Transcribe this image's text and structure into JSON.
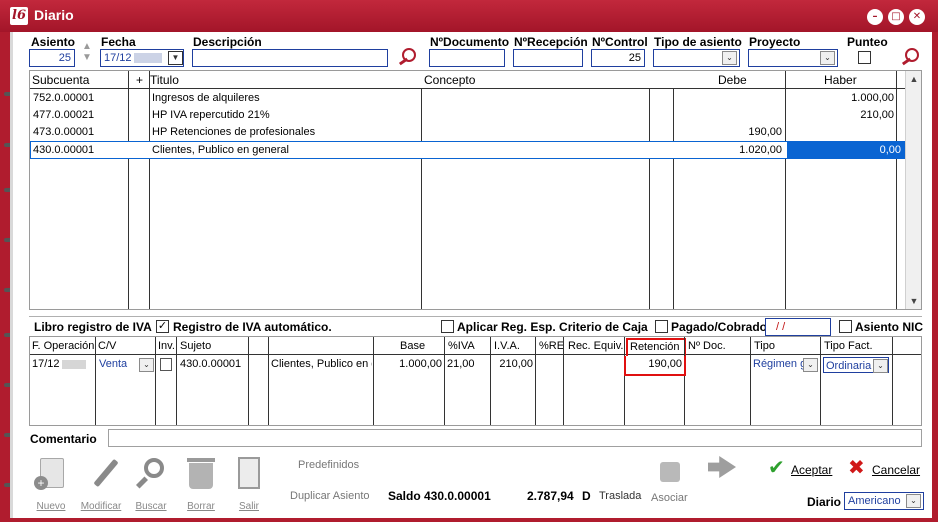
{
  "window": {
    "title": "Diario",
    "logo": "l6"
  },
  "header": {
    "asiento_label": "Asiento",
    "asiento_value": "25",
    "fecha_label": "Fecha",
    "fecha_value": "17/12",
    "descripcion_label": "Descripción",
    "descripcion_value": "",
    "ndocumento_label": "NºDocumento",
    "nrecepcion_label": "NºRecepción",
    "ncontrol_label": "NºControl",
    "ncontrol_value": "25",
    "tipo_asiento_label": "Tipo de asiento",
    "proyecto_label": "Proyecto",
    "punteo_label": "Punteo"
  },
  "grid": {
    "columns": {
      "subcuenta": "Subcuenta",
      "plus": "+",
      "titulo": "Titulo",
      "concepto": "Concepto",
      "debe": "Debe",
      "haber": "Haber"
    },
    "rows": [
      {
        "subcuenta": "752.0.00001",
        "titulo": "Ingresos de alquileres",
        "concepto": "",
        "debe": "",
        "haber": "1.000,00"
      },
      {
        "subcuenta": "477.0.00021",
        "titulo": "HP IVA repercutido 21%",
        "concepto": "",
        "debe": "",
        "haber": "210,00"
      },
      {
        "subcuenta": "473.0.00001",
        "titulo": "HP Retenciones de profesionales",
        "concepto": "",
        "debe": "190,00",
        "haber": ""
      },
      {
        "subcuenta": "430.0.00001",
        "titulo": "Clientes, Publico en general",
        "concepto": "",
        "debe": "1.020,00",
        "haber": "0,00"
      }
    ]
  },
  "iva_bar": {
    "libro_label": "Libro registro de IVA",
    "registro_auto_label": "Registro de IVA automático.",
    "registro_auto_check": "✓",
    "aplicar_label": "Aplicar Reg. Esp. Criterio de Caja",
    "pagado_label": "Pagado/Cobrado",
    "pagado_date": "/ /",
    "asiento_nic_label": "Asiento NIC"
  },
  "iva_grid": {
    "columns": {
      "f_operacion": "F. Operación",
      "cv": "C/V",
      "inv": "Inv.",
      "sujeto": "Sujeto",
      "base": "Base",
      "piva": "%IVA",
      "iva": "I.V.A.",
      "pre": "%RE",
      "rec_equiv": "Rec. Equiv.",
      "retencion": "Retención",
      "ndoc": "Nº Doc.",
      "tipo": "Tipo",
      "tipo_fact": "Tipo Fact."
    },
    "row": {
      "f_operacion": "17/12",
      "cv": "Venta",
      "sujeto": "430.0.00001",
      "nombre": "Clientes, Publico en g",
      "base": "1.000,00",
      "piva": "21,00",
      "iva": "210,00",
      "pre": "",
      "rec_equiv": "",
      "retencion": "190,00",
      "ndoc": "",
      "tipo": "Régimen g",
      "tipo_fact": "Ordinaria"
    }
  },
  "comentario_label": "Comentario",
  "toolbar": {
    "nuevo": "Nuevo",
    "modificar": "Modificar",
    "buscar": "Buscar",
    "borrar": "Borrar",
    "salir": "Salir",
    "predefinidos": "Predefinidos",
    "duplicar": "Duplicar Asiento",
    "saldo_label": "Saldo 430.0.00001",
    "saldo_value": "2.787,94",
    "saldo_side": "D",
    "traslada": "Traslada",
    "asociar": "Asociar",
    "aceptar": "Aceptar",
    "cancelar": "Cancelar",
    "diario_label": "Diario",
    "diario_value": "Americano"
  },
  "colors": {
    "brand": "#b01c2e",
    "field_border": "#1f3f9f",
    "selected": "#0a64d2",
    "highlight": "#e01010"
  }
}
